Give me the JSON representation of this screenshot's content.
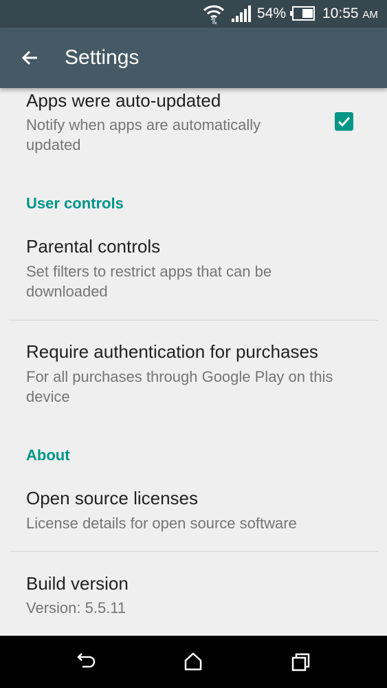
{
  "status_bar": {
    "battery": "54%",
    "time": "10:55",
    "ampm": "AM",
    "icons": [
      "wifi-icon",
      "signal-icon",
      "battery-icon"
    ]
  },
  "app_bar": {
    "title": "Settings",
    "back_icon": "arrow-back-icon"
  },
  "settings": {
    "auto_updated": {
      "title": "Apps were auto-updated",
      "subtitle": "Notify when apps are automatically updated",
      "checked": true
    },
    "user_controls_header": "User controls",
    "parental_controls": {
      "title": "Parental controls",
      "subtitle": "Set filters to restrict apps that can be downloaded"
    },
    "require_auth": {
      "title": "Require authentication for purchases",
      "subtitle": "For all purchases through Google Play on this device"
    },
    "about_header": "About",
    "open_source": {
      "title": "Open source licenses",
      "subtitle": "License details for open source software"
    },
    "build_version": {
      "title": "Build version",
      "subtitle": "Version: 5.5.11"
    }
  },
  "nav_bar": {
    "icons": [
      "back-icon",
      "home-icon",
      "recents-icon"
    ]
  },
  "colors": {
    "accent": "#009688",
    "app_bar": "#455a64",
    "status_bar": "#37474f",
    "background": "#efefef"
  }
}
